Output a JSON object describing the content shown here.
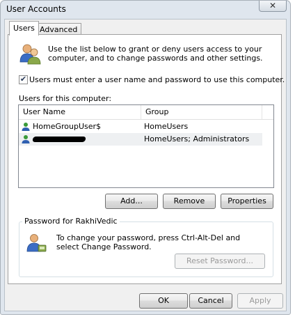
{
  "window": {
    "title": "User Accounts",
    "close_glyph": "✕"
  },
  "tabs": [
    {
      "label": "Users",
      "selected": true
    },
    {
      "label": "Advanced",
      "selected": false
    }
  ],
  "intro": {
    "text": "Use the list below to grant or deny users access to your computer, and to change passwords and other settings."
  },
  "require_login": {
    "checked": true,
    "check_glyph": "✔",
    "label": "Users must enter a user name and password to use this computer."
  },
  "users_section": {
    "label": "Users for this computer:",
    "columns": [
      "User Name",
      "Group"
    ],
    "rows": [
      {
        "name": "HomeGroupUser$",
        "group": "HomeUsers",
        "icon": "user-icon"
      },
      {
        "name": "",
        "group": "HomeUsers; Administrators",
        "icon": "user-icon",
        "redacted": true
      }
    ]
  },
  "list_buttons": {
    "add": "Add...",
    "remove": "Remove",
    "properties": "Properties"
  },
  "password_group": {
    "label": "Password for RakhiVedic",
    "text": "To change your password, press Ctrl-Alt-Del and select Change Password.",
    "reset_button": "Reset Password..."
  },
  "footer": {
    "ok": "OK",
    "cancel": "Cancel",
    "apply": "Apply"
  }
}
